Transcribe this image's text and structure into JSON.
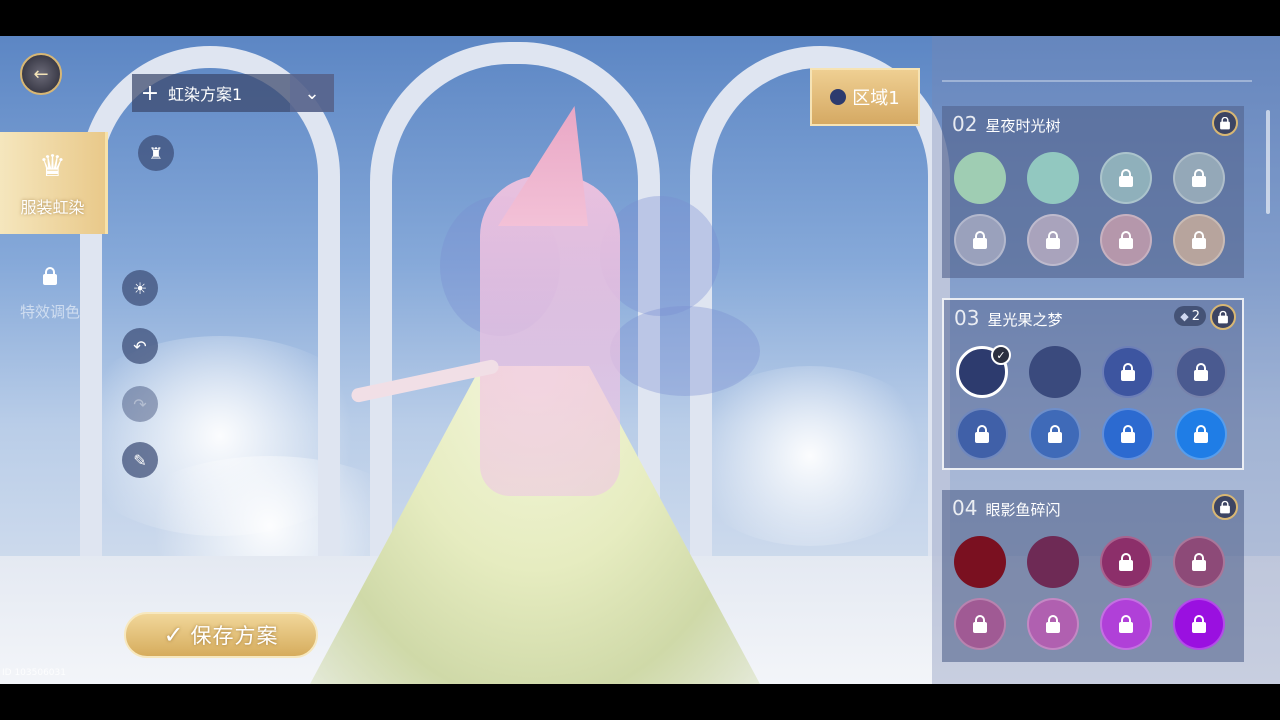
{
  "header": {
    "back_icon": "back-arrow-icon",
    "scheme": {
      "add_symbol": "+",
      "name": "虹染方案1",
      "dropdown_symbol": "⌄"
    }
  },
  "left_tabs": [
    {
      "label": "服装虹染",
      "icon": "outfit-icon",
      "active": true
    },
    {
      "label": "特效调色",
      "icon": "lock-icon",
      "active": false,
      "locked": true
    }
  ],
  "tools": [
    {
      "icon": "outfit-toggle-icon",
      "enabled": true
    },
    {
      "icon": "brightness-icon",
      "enabled": true
    },
    {
      "icon": "undo-icon",
      "enabled": true
    },
    {
      "icon": "redo-icon",
      "enabled": false
    },
    {
      "icon": "brush-icon",
      "enabled": true
    }
  ],
  "save_button": {
    "check": "✓",
    "label": "保存方案"
  },
  "player_id": "ID 103506031",
  "region": {
    "label": "区域1",
    "dot_color": "#2d3b6e"
  },
  "palette_groups": [
    {
      "number": "02",
      "title": "星夜时光树",
      "locked": true,
      "count": "",
      "swatches": [
        {
          "color": "#9fcdb3",
          "locked": false
        },
        {
          "color": "#92c8c0",
          "locked": false
        },
        {
          "color": "#8fb0bb",
          "locked": true
        },
        {
          "color": "#94a8b8",
          "locked": true
        },
        {
          "color": "#9aa1bc",
          "locked": true
        },
        {
          "color": "#a9a3bc",
          "locked": true
        },
        {
          "color": "#b597ab",
          "locked": true
        },
        {
          "color": "#b7a49d",
          "locked": true
        }
      ]
    },
    {
      "number": "03",
      "title": "星光果之梦",
      "locked": true,
      "count": "2",
      "selected": true,
      "swatches": [
        {
          "color": "#2d3b6e",
          "locked": false,
          "active": true
        },
        {
          "color": "#3a4a7d",
          "locked": false
        },
        {
          "color": "#3d55a0",
          "locked": true
        },
        {
          "color": "#4a5a90",
          "locked": true
        },
        {
          "color": "#4060a8",
          "locked": true
        },
        {
          "color": "#3f6ab8",
          "locked": true
        },
        {
          "color": "#2c6ad0",
          "locked": true
        },
        {
          "color": "#1f7de6",
          "locked": true
        }
      ]
    },
    {
      "number": "04",
      "title": "眼影鱼碎闪",
      "locked": true,
      "count": "",
      "swatches": [
        {
          "color": "#7a1020",
          "locked": false
        },
        {
          "color": "#6e2a55",
          "locked": false
        },
        {
          "color": "#8c2f6a",
          "locked": true
        },
        {
          "color": "#8d4a78",
          "locked": true
        },
        {
          "color": "#a05a94",
          "locked": true
        },
        {
          "color": "#b060b0",
          "locked": true
        },
        {
          "color": "#b040d8",
          "locked": true
        },
        {
          "color": "#9a10e0",
          "locked": true
        }
      ]
    }
  ]
}
